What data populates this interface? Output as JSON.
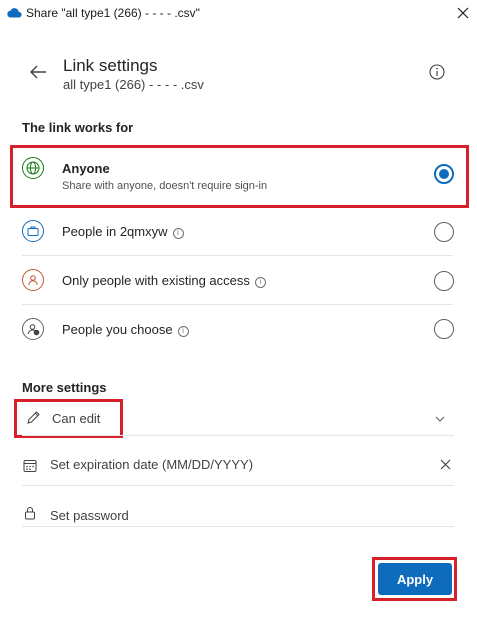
{
  "window": {
    "title": "Share \"all type1 (266) - - - - .csv\""
  },
  "header": {
    "title": "Link settings",
    "subtitle": "all type1 (266) - - - - .csv"
  },
  "link_works_for": {
    "heading": "The link works for",
    "options": [
      {
        "label": "Anyone",
        "description": "Share with anyone, doesn't require sign-in",
        "selected": true,
        "icon": "globe-icon"
      },
      {
        "label": "People in 2qmxyw",
        "selected": false,
        "icon": "briefcase-icon"
      },
      {
        "label": "Only people with existing access",
        "selected": false,
        "icon": "person-icon"
      },
      {
        "label": "People you choose",
        "selected": false,
        "icon": "person-lock-icon"
      }
    ]
  },
  "more_settings": {
    "heading": "More settings",
    "permission": {
      "value": "Can edit"
    },
    "expiration": {
      "placeholder": "Set expiration date (MM/DD/YYYY)"
    },
    "password": {
      "placeholder": "Set password"
    }
  },
  "footer": {
    "apply_label": "Apply"
  },
  "colors": {
    "accent": "#0f6cbd",
    "highlight": "#d8202a",
    "globe": "#107c10",
    "briefcase": "#0f6cbd",
    "person": "#c0562f"
  }
}
